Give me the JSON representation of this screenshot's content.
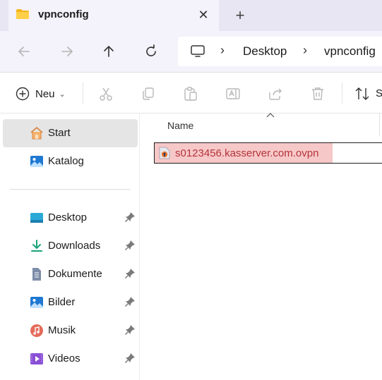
{
  "tab": {
    "title": "vpnconfig",
    "close_label": "✕",
    "new_label": "+"
  },
  "nav": {
    "back_icon": "arrow-left-icon",
    "forward_icon": "arrow-right-icon",
    "up_icon": "arrow-up-icon",
    "refresh_icon": "refresh-icon",
    "breadcrumb": [
      "Desktop",
      "vpnconfig"
    ],
    "separator": "›"
  },
  "commandbar": {
    "new_label": "Neu",
    "new_chevron": "⌄",
    "sort_label": "S",
    "icons": [
      "cut-icon",
      "copy-icon",
      "paste-icon",
      "rename-icon",
      "share-icon",
      "delete-icon",
      "sort-icon"
    ]
  },
  "sidebar": {
    "items": [
      {
        "label": "Start",
        "icon": "home-icon",
        "selected": true
      },
      {
        "label": "Katalog",
        "icon": "gallery-icon"
      }
    ],
    "pinned": [
      {
        "label": "Desktop",
        "icon": "desktop-icon"
      },
      {
        "label": "Downloads",
        "icon": "download-icon"
      },
      {
        "label": "Dokumente",
        "icon": "document-icon"
      },
      {
        "label": "Bilder",
        "icon": "pictures-icon"
      },
      {
        "label": "Musik",
        "icon": "music-icon"
      },
      {
        "label": "Videos",
        "icon": "video-icon"
      }
    ]
  },
  "content": {
    "column_name": "Name",
    "files": [
      {
        "name": "s0123456.kasserver.com.ovpn",
        "icon": "ovpn-file-icon"
      }
    ]
  },
  "colors": {
    "highlight": "#f7c8c8",
    "filename_text": "#b4343a",
    "selected_bg": "#e5e5e5"
  }
}
